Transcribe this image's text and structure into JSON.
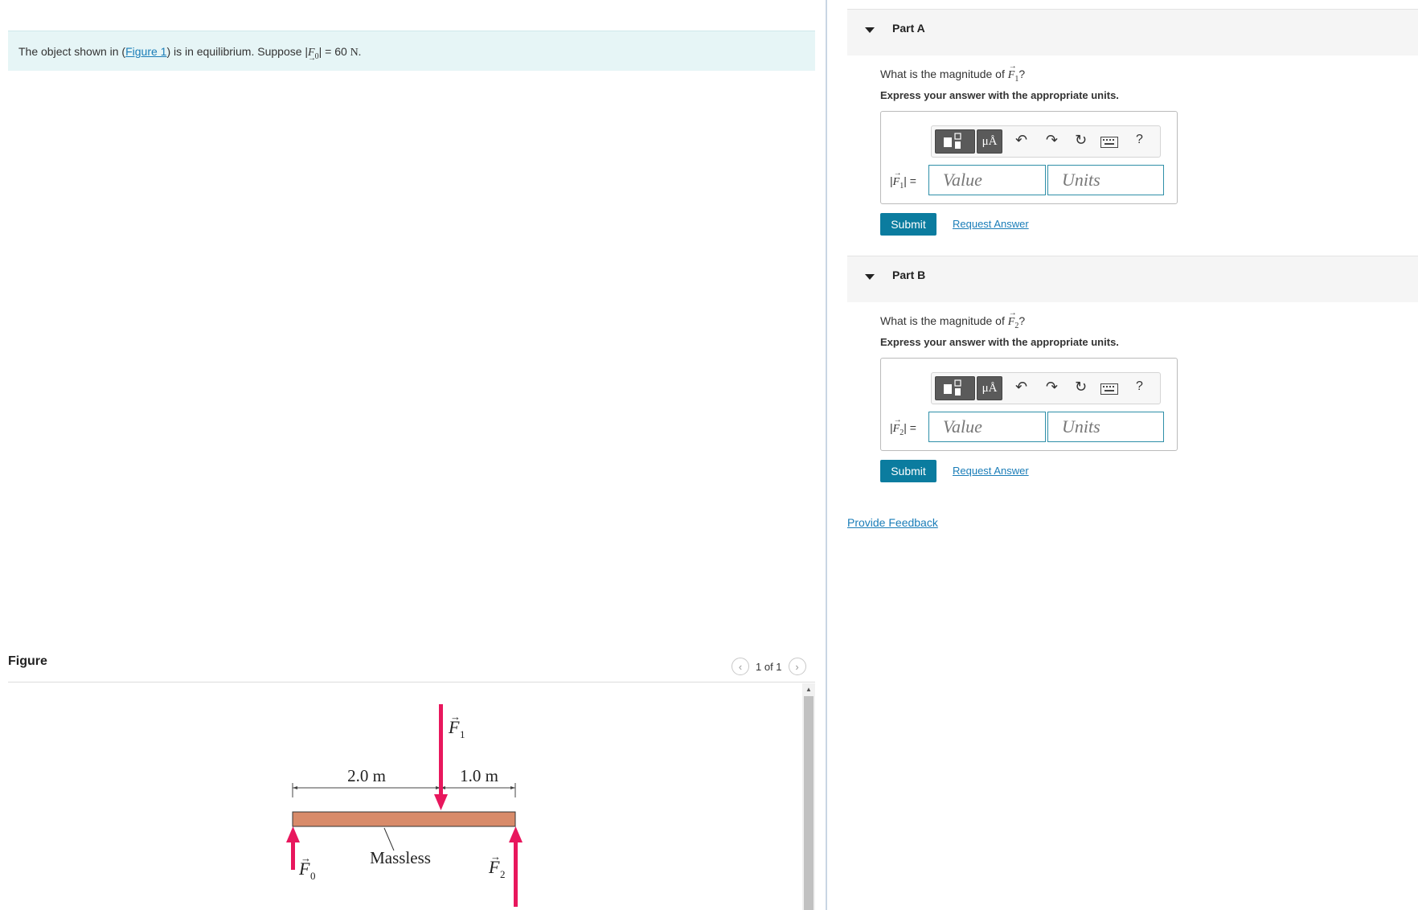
{
  "problem": {
    "text_before": "The object shown in (",
    "figure_link": "Figure 1",
    "text_after": ") is in equilibrium. Suppose |",
    "force_symbol": "F",
    "force_sub": "0",
    "value_text": "| = 60 ",
    "unit": "N."
  },
  "figure": {
    "title": "Figure",
    "pager_text": "1 of 1",
    "labels": {
      "dist1": "2.0 m",
      "dist2": "1.0 m",
      "massless": "Massless",
      "f1": "F",
      "f1_sub": "1",
      "f0": "F",
      "f0_sub": "0",
      "f2": "F",
      "f2_sub": "2"
    },
    "colors": {
      "arrow": "#e8175d",
      "beam": "#d88b6a"
    }
  },
  "parts": [
    {
      "title": "Part A",
      "question_prefix": "What is the magnitude of ",
      "symbol": "F",
      "sub": "1",
      "question_suffix": "?",
      "instruction": "Express your answer with the appropriate units.",
      "label": "| =",
      "value_placeholder": "Value",
      "units_placeholder": "Units",
      "unit_button": "μÅ",
      "submit": "Submit",
      "request": "Request Answer"
    },
    {
      "title": "Part B",
      "question_prefix": "What is the magnitude of ",
      "symbol": "F",
      "sub": "2",
      "question_suffix": "?",
      "instruction": "Express your answer with the appropriate units.",
      "label": "| =",
      "value_placeholder": "Value",
      "units_placeholder": "Units",
      "unit_button": "μÅ",
      "submit": "Submit",
      "request": "Request Answer"
    }
  ],
  "toolbar_icons": [
    "undo-icon",
    "redo-icon",
    "reset-icon",
    "keyboard-icon",
    "help-icon"
  ],
  "help_symbol": "?",
  "feedback": "Provide Feedback"
}
